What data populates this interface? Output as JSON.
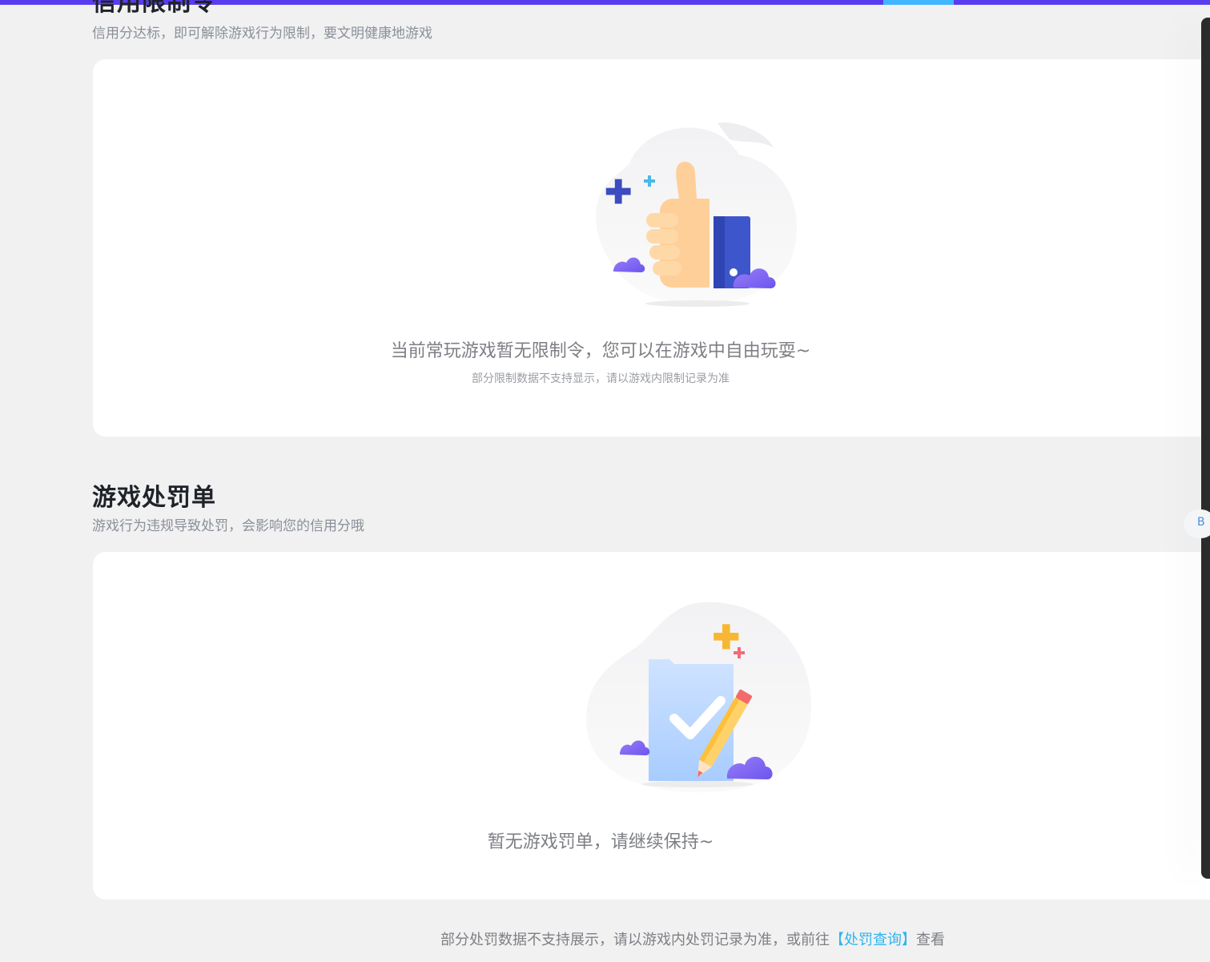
{
  "credit_section": {
    "title": "信用限制令",
    "subtitle": "信用分达标，即可解除游戏行为限制，要文明健康地游戏",
    "empty_message": "当前常玩游戏暂无限制令，您可以在游戏中自由玩耍~",
    "note": "部分限制数据不支持显示，请以游戏内限制记录为准",
    "illustration_icon": "thumbs-up-icon"
  },
  "penalty_section": {
    "title": "游戏处罚单",
    "subtitle": "游戏行为违规导致处罚，会影响您的信用分哦",
    "empty_message": "暂无游戏罚单，请继续保持~",
    "illustration_icon": "checklist-pencil-icon"
  },
  "footer": {
    "text_before": "部分处罚数据不支持展示，请以游戏内处罚记录为准，或前往",
    "link_label": "【处罚查询】",
    "text_after": "查看"
  },
  "float_button": {
    "label": "B"
  },
  "colors": {
    "top_bar": "#5a3cf0",
    "accent_link": "#2db4f0",
    "card_bg": "#ffffff",
    "page_bg": "#f1f1f1"
  }
}
